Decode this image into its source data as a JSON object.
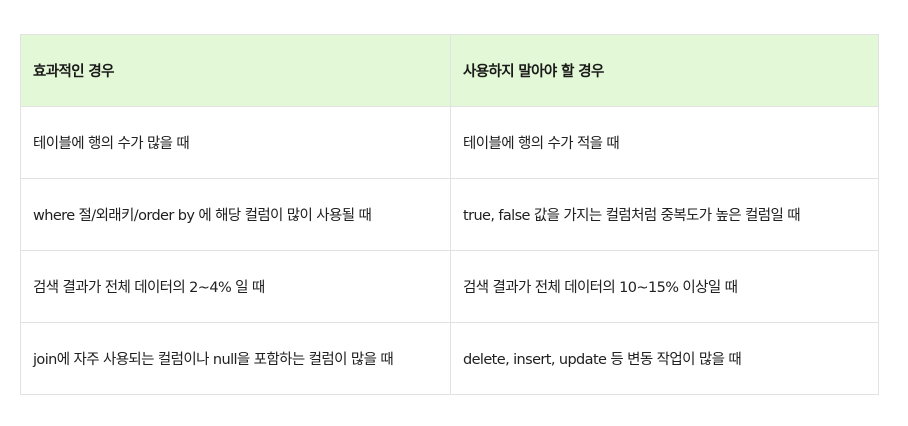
{
  "table": {
    "headers": [
      "효과적인 경우",
      "사용하지 말아야 할 경우"
    ],
    "rows": [
      [
        "테이블에 행의 수가 많을 때",
        "테이블에 행의 수가 적을 때"
      ],
      [
        "where 절/외래키/order by 에 해당 컬럼이 많이 사용될 때",
        "true, false 값을 가지는 컬럼처럼 중복도가 높은 컬럼일 때"
      ],
      [
        "검색 결과가 전체 데이터의 2~4% 일 때",
        "검색 결과가 전체 데이터의  10~15% 이상일 때"
      ],
      [
        "join에 자주 사용되는 컬럼이나 null을 포함하는 컬럼이 많을 때",
        "delete, insert, update 등 변동 작업이 많을 때"
      ]
    ]
  },
  "colors": {
    "header_background": "#e3f8d6",
    "border": "#e2e2e2"
  }
}
